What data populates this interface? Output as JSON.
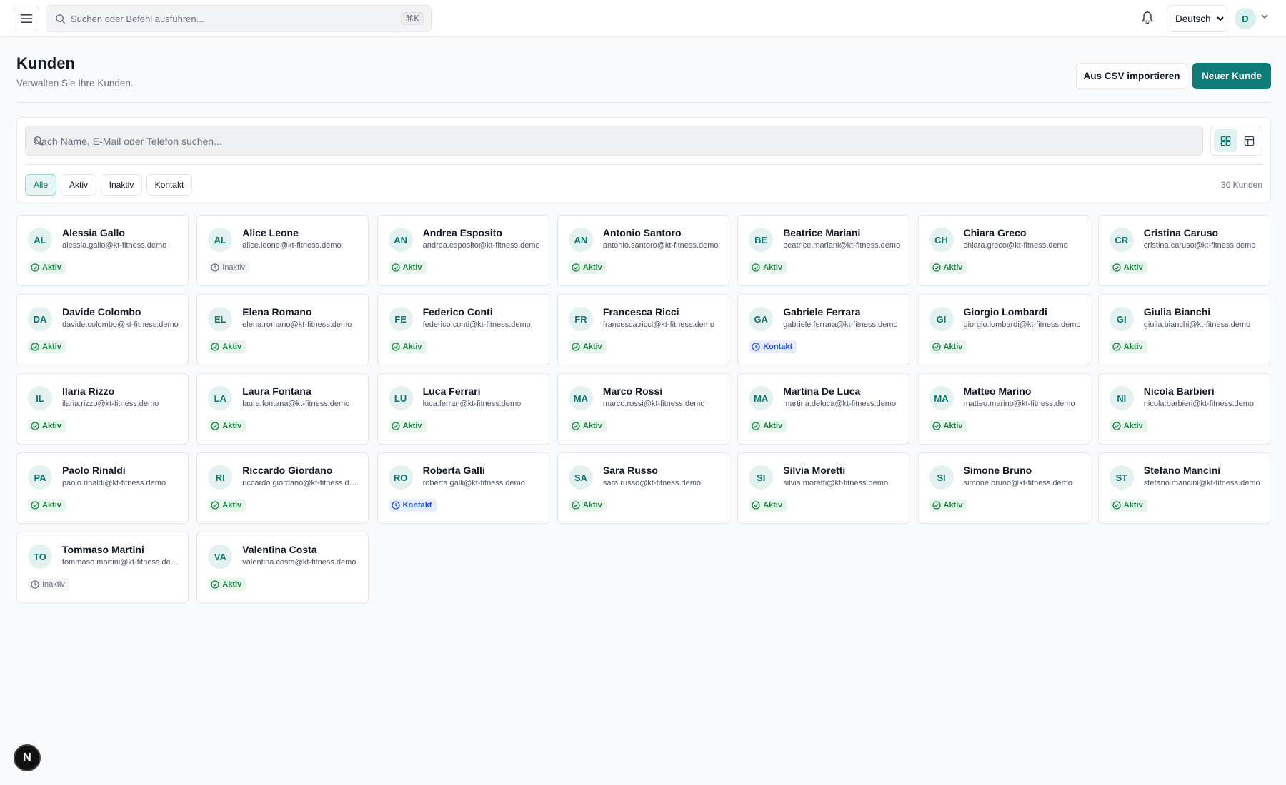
{
  "topbar": {
    "search_placeholder": "Suchen oder Befehl ausführen...",
    "shortcut": "⌘K",
    "language": "Deutsch",
    "user_initial": "D"
  },
  "header": {
    "title": "Kunden",
    "subtitle": "Verwalten Sie Ihre Kunden.",
    "import_label": "Aus CSV importieren",
    "new_label": "Neuer Kunde"
  },
  "filters": {
    "search_placeholder": "Nach Name, E-Mail oder Telefon suchen...",
    "chips": [
      "Alle",
      "Aktiv",
      "Inaktiv",
      "Kontakt"
    ],
    "active_chip": "Alle",
    "count_label": "30 Kunden"
  },
  "status_labels": {
    "aktiv": "Aktiv",
    "inaktiv": "Inaktiv",
    "kontakt": "Kontakt"
  },
  "customers": [
    {
      "initials": "AL",
      "name": "Alessia Gallo",
      "email": "alessia.gallo@kt-fitness.demo",
      "status": "aktiv"
    },
    {
      "initials": "AL",
      "name": "Alice Leone",
      "email": "alice.leone@kt-fitness.demo",
      "status": "inaktiv"
    },
    {
      "initials": "AN",
      "name": "Andrea Esposito",
      "email": "andrea.esposito@kt-fitness.demo",
      "status": "aktiv"
    },
    {
      "initials": "AN",
      "name": "Antonio Santoro",
      "email": "antonio.santoro@kt-fitness.demo",
      "status": "aktiv"
    },
    {
      "initials": "BE",
      "name": "Beatrice Mariani",
      "email": "beatrice.mariani@kt-fitness.demo",
      "status": "aktiv"
    },
    {
      "initials": "CH",
      "name": "Chiara Greco",
      "email": "chiara.greco@kt-fitness.demo",
      "status": "aktiv"
    },
    {
      "initials": "CR",
      "name": "Cristina Caruso",
      "email": "cristina.caruso@kt-fitness.demo",
      "status": "aktiv"
    },
    {
      "initials": "DA",
      "name": "Davide Colombo",
      "email": "davide.colombo@kt-fitness.demo",
      "status": "aktiv"
    },
    {
      "initials": "EL",
      "name": "Elena Romano",
      "email": "elena.romano@kt-fitness.demo",
      "status": "aktiv"
    },
    {
      "initials": "FE",
      "name": "Federico Conti",
      "email": "federico.conti@kt-fitness.demo",
      "status": "aktiv"
    },
    {
      "initials": "FR",
      "name": "Francesca Ricci",
      "email": "francesca.ricci@kt-fitness.demo",
      "status": "aktiv"
    },
    {
      "initials": "GA",
      "name": "Gabriele Ferrara",
      "email": "gabriele.ferrara@kt-fitness.demo",
      "status": "kontakt"
    },
    {
      "initials": "GI",
      "name": "Giorgio Lombardi",
      "email": "giorgio.lombardi@kt-fitness.demo",
      "status": "aktiv"
    },
    {
      "initials": "GI",
      "name": "Giulia Bianchi",
      "email": "giulia.bianchi@kt-fitness.demo",
      "status": "aktiv"
    },
    {
      "initials": "IL",
      "name": "Ilaria Rizzo",
      "email": "ilaria.rizzo@kt-fitness.demo",
      "status": "aktiv"
    },
    {
      "initials": "LA",
      "name": "Laura Fontana",
      "email": "laura.fontana@kt-fitness.demo",
      "status": "aktiv"
    },
    {
      "initials": "LU",
      "name": "Luca Ferrari",
      "email": "luca.ferrari@kt-fitness.demo",
      "status": "aktiv"
    },
    {
      "initials": "MA",
      "name": "Marco Rossi",
      "email": "marco.rossi@kt-fitness.demo",
      "status": "aktiv"
    },
    {
      "initials": "MA",
      "name": "Martina De Luca",
      "email": "martina.deluca@kt-fitness.demo",
      "status": "aktiv"
    },
    {
      "initials": "MA",
      "name": "Matteo Marino",
      "email": "matteo.marino@kt-fitness.demo",
      "status": "aktiv"
    },
    {
      "initials": "NI",
      "name": "Nicola Barbieri",
      "email": "nicola.barbieri@kt-fitness.demo",
      "status": "aktiv"
    },
    {
      "initials": "PA",
      "name": "Paolo Rinaldi",
      "email": "paolo.rinaldi@kt-fitness.demo",
      "status": "aktiv"
    },
    {
      "initials": "RI",
      "name": "Riccardo Giordano",
      "email": "riccardo.giordano@kt-fitness.demo",
      "status": "aktiv"
    },
    {
      "initials": "RO",
      "name": "Roberta Galli",
      "email": "roberta.galli@kt-fitness.demo",
      "status": "kontakt"
    },
    {
      "initials": "SA",
      "name": "Sara Russo",
      "email": "sara.russo@kt-fitness.demo",
      "status": "aktiv"
    },
    {
      "initials": "SI",
      "name": "Silvia Moretti",
      "email": "silvia.moretti@kt-fitness.demo",
      "status": "aktiv"
    },
    {
      "initials": "SI",
      "name": "Simone Bruno",
      "email": "simone.bruno@kt-fitness.demo",
      "status": "aktiv"
    },
    {
      "initials": "ST",
      "name": "Stefano Mancini",
      "email": "stefano.mancini@kt-fitness.demo",
      "status": "aktiv"
    },
    {
      "initials": "TO",
      "name": "Tommaso Martini",
      "email": "tommaso.martini@kt-fitness.demo",
      "status": "inaktiv"
    },
    {
      "initials": "VA",
      "name": "Valentina Costa",
      "email": "valentina.costa@kt-fitness.demo",
      "status": "aktiv"
    }
  ],
  "fab_label": "N"
}
